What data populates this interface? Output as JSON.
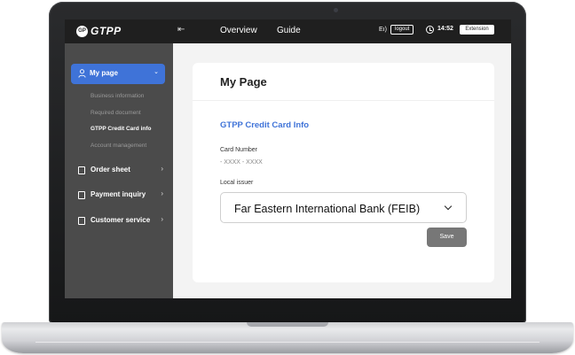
{
  "header": {
    "logo_mark": "GP",
    "logo_text": "GTPP",
    "nav": [
      {
        "label": "Overview"
      },
      {
        "label": "Guide"
      }
    ],
    "language": "Eı)",
    "logout_label": "logout",
    "clock": "14:52",
    "extension_label": "Extension"
  },
  "sidebar": {
    "active": {
      "label": "My page",
      "icon": "user-icon"
    },
    "sub_items": [
      {
        "label": "Business information"
      },
      {
        "label": "Required document"
      },
      {
        "label": "GTPP Credit Card info"
      },
      {
        "label": "Account management"
      }
    ],
    "items": [
      {
        "label": "Order sheet",
        "icon": "document-icon"
      },
      {
        "label": "Payment inquiry",
        "icon": "clipboard-icon"
      },
      {
        "label": "Customer service",
        "icon": "grid-icon"
      }
    ]
  },
  "main": {
    "title": "My Page",
    "section_title": "GTPP Credit Card Info",
    "card_number_label": "Card Number",
    "card_number_value": "- XXXX - XXXX",
    "issuer_label": "Local issuer",
    "issuer_value": "Far Eastern International Bank (FEIB)",
    "save_label": "Save"
  },
  "colors": {
    "accent": "#3f73d8",
    "topbar": "#1f1f1f",
    "sidebar": "#4b4b4b",
    "content_bg": "#f3f3f3",
    "save_button": "#777777"
  }
}
